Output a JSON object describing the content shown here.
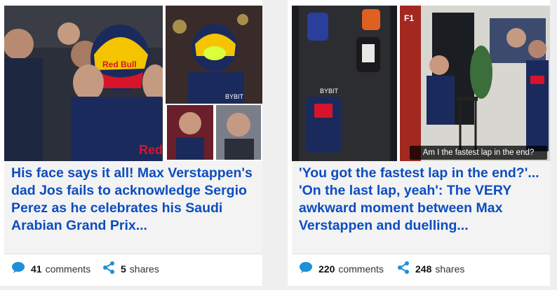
{
  "articles": [
    {
      "headline": "His face says it all! Max Verstappen's dad Jos fails to acknowledge Sergio Perez as he celebrates his Saudi Arabian Grand Prix...",
      "comments_count": "41",
      "comments_label": "comments",
      "shares_count": "5",
      "shares_label": "shares",
      "image_description_icons": [
        "photo-icon"
      ]
    },
    {
      "headline": "'You got the fastest lap in the end?'... 'On the last lap, yeah': The VERY awkward moment between Max Verstappen and duelling...",
      "comments_count": "220",
      "comments_label": "comments",
      "shares_count": "248",
      "shares_label": "shares",
      "image_caption": "Am I the fastest lap in the end?"
    }
  ],
  "colors": {
    "headline": "#0d4dbf",
    "icon": "#1e90d6",
    "redbull_navy": "#1b2a5c",
    "redbull_red": "#d7152a",
    "redbull_yellow": "#f4c400"
  },
  "icons": {
    "comments": "speech-bubble-icon",
    "shares": "share-icon"
  }
}
